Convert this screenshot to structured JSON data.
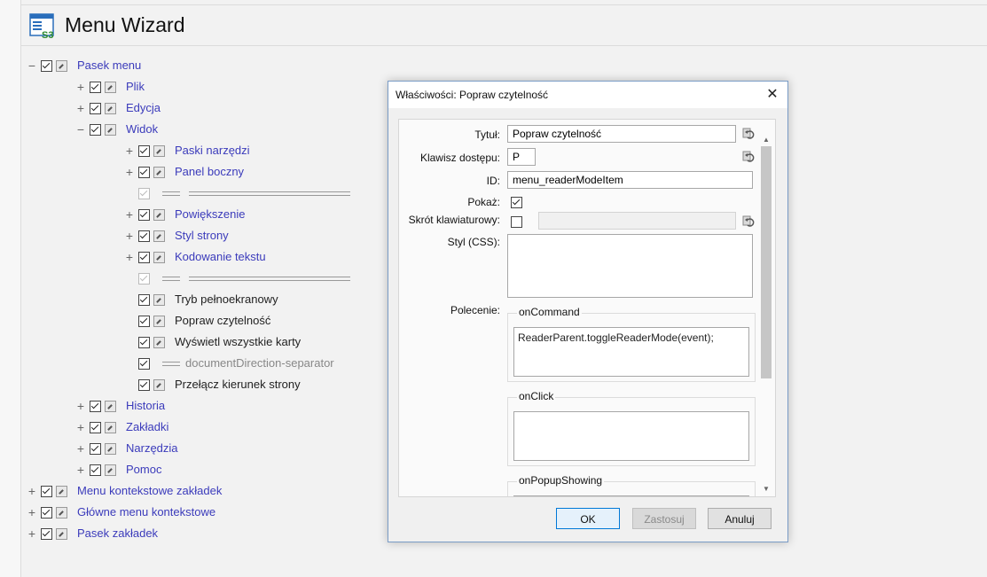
{
  "app": {
    "title": "Menu Wizard",
    "icon": "s3-menu-wizard-icon"
  },
  "tree": {
    "collapse_symbol": "−",
    "expand_symbol": "+",
    "items": [
      {
        "label": "Pasek menu",
        "expander": "−",
        "checked": true
      },
      {
        "label": "Plik",
        "expander": "+",
        "checked": true
      },
      {
        "label": "Edycja",
        "expander": "+",
        "checked": true
      },
      {
        "label": "Widok",
        "expander": "−",
        "checked": true
      },
      {
        "label": "Paski narzędzi",
        "expander": "+",
        "checked": true
      },
      {
        "label": "Panel boczny",
        "expander": "+",
        "checked": true
      },
      {
        "label": "",
        "separator": true,
        "checked": true
      },
      {
        "label": "Powiększenie",
        "expander": "+",
        "checked": true
      },
      {
        "label": "Styl strony",
        "expander": "+",
        "checked": true
      },
      {
        "label": "Kodowanie tekstu",
        "expander": "+",
        "checked": true
      },
      {
        "label": "",
        "separator": true,
        "checked": true
      },
      {
        "label": "Tryb pełnoekranowy",
        "checked": true
      },
      {
        "label": "Popraw czytelność",
        "checked": true
      },
      {
        "label": "Wyświetl wszystkie karty",
        "checked": true
      },
      {
        "label": "documentDirection-separator",
        "separator": true,
        "checked": true
      },
      {
        "label": "Przełącz kierunek strony",
        "checked": true
      },
      {
        "label": "Historia",
        "expander": "+",
        "checked": true
      },
      {
        "label": "Zakładki",
        "expander": "+",
        "checked": true
      },
      {
        "label": "Narzędzia",
        "expander": "+",
        "checked": true
      },
      {
        "label": "Pomoc",
        "expander": "+",
        "checked": true
      },
      {
        "label": "Menu kontekstowe zakładek",
        "expander": "+",
        "checked": true
      },
      {
        "label": "Główne menu kontekstowe",
        "expander": "+",
        "checked": true
      },
      {
        "label": "Pasek zakładek",
        "expander": "+",
        "checked": true
      }
    ]
  },
  "dialog": {
    "title": "Właściwości: Popraw czytelność",
    "close_icon": "close-icon",
    "fields": {
      "title_label": "Tytuł:",
      "title_value": "Popraw czytelność",
      "accesskey_label": "Klawisz dostępu:",
      "accesskey_value": "P",
      "id_label": "ID:",
      "id_value": "menu_readerModeItem",
      "show_label": "Pokaż:",
      "show_checked": true,
      "shortcut_label": "Skrót klawiaturowy:",
      "shortcut_checked": false,
      "shortcut_value": "",
      "style_label": "Styl (CSS):",
      "style_value": "",
      "command_label": "Polecenie:"
    },
    "groups": {
      "oncommand_title": "onCommand",
      "oncommand_value": "ReaderParent.toggleReaderMode(event);",
      "onclick_title": "onClick",
      "onclick_value": "",
      "onpopupshowing_title": "onPopupShowing"
    },
    "buttons": {
      "ok": "OK",
      "apply": "Zastosuj",
      "cancel": "Anuluj"
    }
  }
}
